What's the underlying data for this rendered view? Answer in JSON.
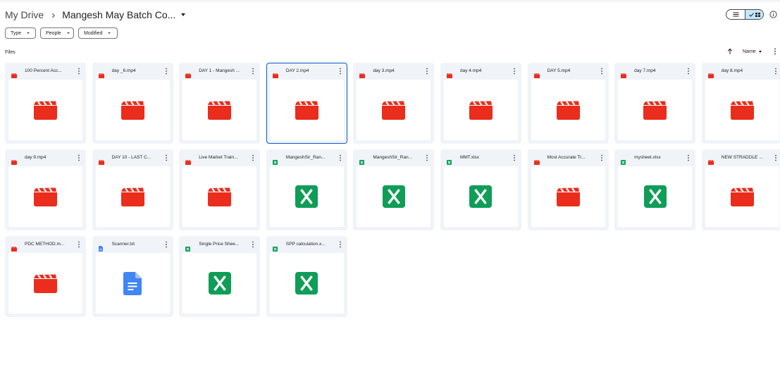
{
  "breadcrumb": {
    "root": "My Drive",
    "separator": "›",
    "current": "Mangesh May Batch Co..."
  },
  "filters": [
    {
      "label": "Type"
    },
    {
      "label": "People"
    },
    {
      "label": "Modified"
    }
  ],
  "section_title": "Files",
  "sort": {
    "label": "Name"
  },
  "colors": {
    "video": "#ea2d1c",
    "sheet": "#0f9d58",
    "doc": "#4285f4",
    "selected_border": "#0b57d0",
    "card_bg": "#f0f4f9",
    "toggle_active": "#c2e7ff"
  },
  "files": [
    {
      "name": "100 Percent Acc...",
      "type": "video",
      "icon": "video-icon"
    },
    {
      "name": "day _6.mp4",
      "type": "video",
      "icon": "video-icon"
    },
    {
      "name": "DAY 1 - Mangesh ...",
      "type": "video",
      "icon": "video-icon"
    },
    {
      "name": "DAY 2.mp4",
      "type": "video",
      "icon": "video-icon",
      "selected": true
    },
    {
      "name": "day 3.mp4",
      "type": "video",
      "icon": "video-icon"
    },
    {
      "name": "day 4.mp4",
      "type": "video",
      "icon": "video-icon"
    },
    {
      "name": "DAY 5.mp4",
      "type": "video",
      "icon": "video-icon"
    },
    {
      "name": "day 7.mp4",
      "type": "video",
      "icon": "video-icon"
    },
    {
      "name": "day 8.mp4",
      "type": "video",
      "icon": "video-icon"
    },
    {
      "name": "day 9.mp4",
      "type": "video",
      "icon": "video-icon"
    },
    {
      "name": "DAY 10 - LAST C...",
      "type": "video",
      "icon": "video-icon"
    },
    {
      "name": "Live Market Train...",
      "type": "video",
      "icon": "video-icon"
    },
    {
      "name": "MangeshSir_Ran...",
      "type": "sheet",
      "icon": "spreadsheet-icon"
    },
    {
      "name": "MangeshSir_Ran...",
      "type": "sheet",
      "icon": "spreadsheet-icon"
    },
    {
      "name": "MMT.xlsx",
      "type": "sheet",
      "icon": "spreadsheet-icon"
    },
    {
      "name": "Most Accurate Tr...",
      "type": "video",
      "icon": "video-icon"
    },
    {
      "name": "mysheet.xlsx",
      "type": "sheet",
      "icon": "spreadsheet-icon"
    },
    {
      "name": "NEW STRADDLE ...",
      "type": "video",
      "icon": "video-icon"
    },
    {
      "name": "PDC METHOD.m...",
      "type": "video",
      "icon": "video-icon"
    },
    {
      "name": "Scanner.txt",
      "type": "doc",
      "icon": "text-document-icon"
    },
    {
      "name": "Single Price Shee...",
      "type": "sheet",
      "icon": "spreadsheet-icon"
    },
    {
      "name": "SPP calculation.x...",
      "type": "sheet",
      "icon": "spreadsheet-icon"
    }
  ]
}
